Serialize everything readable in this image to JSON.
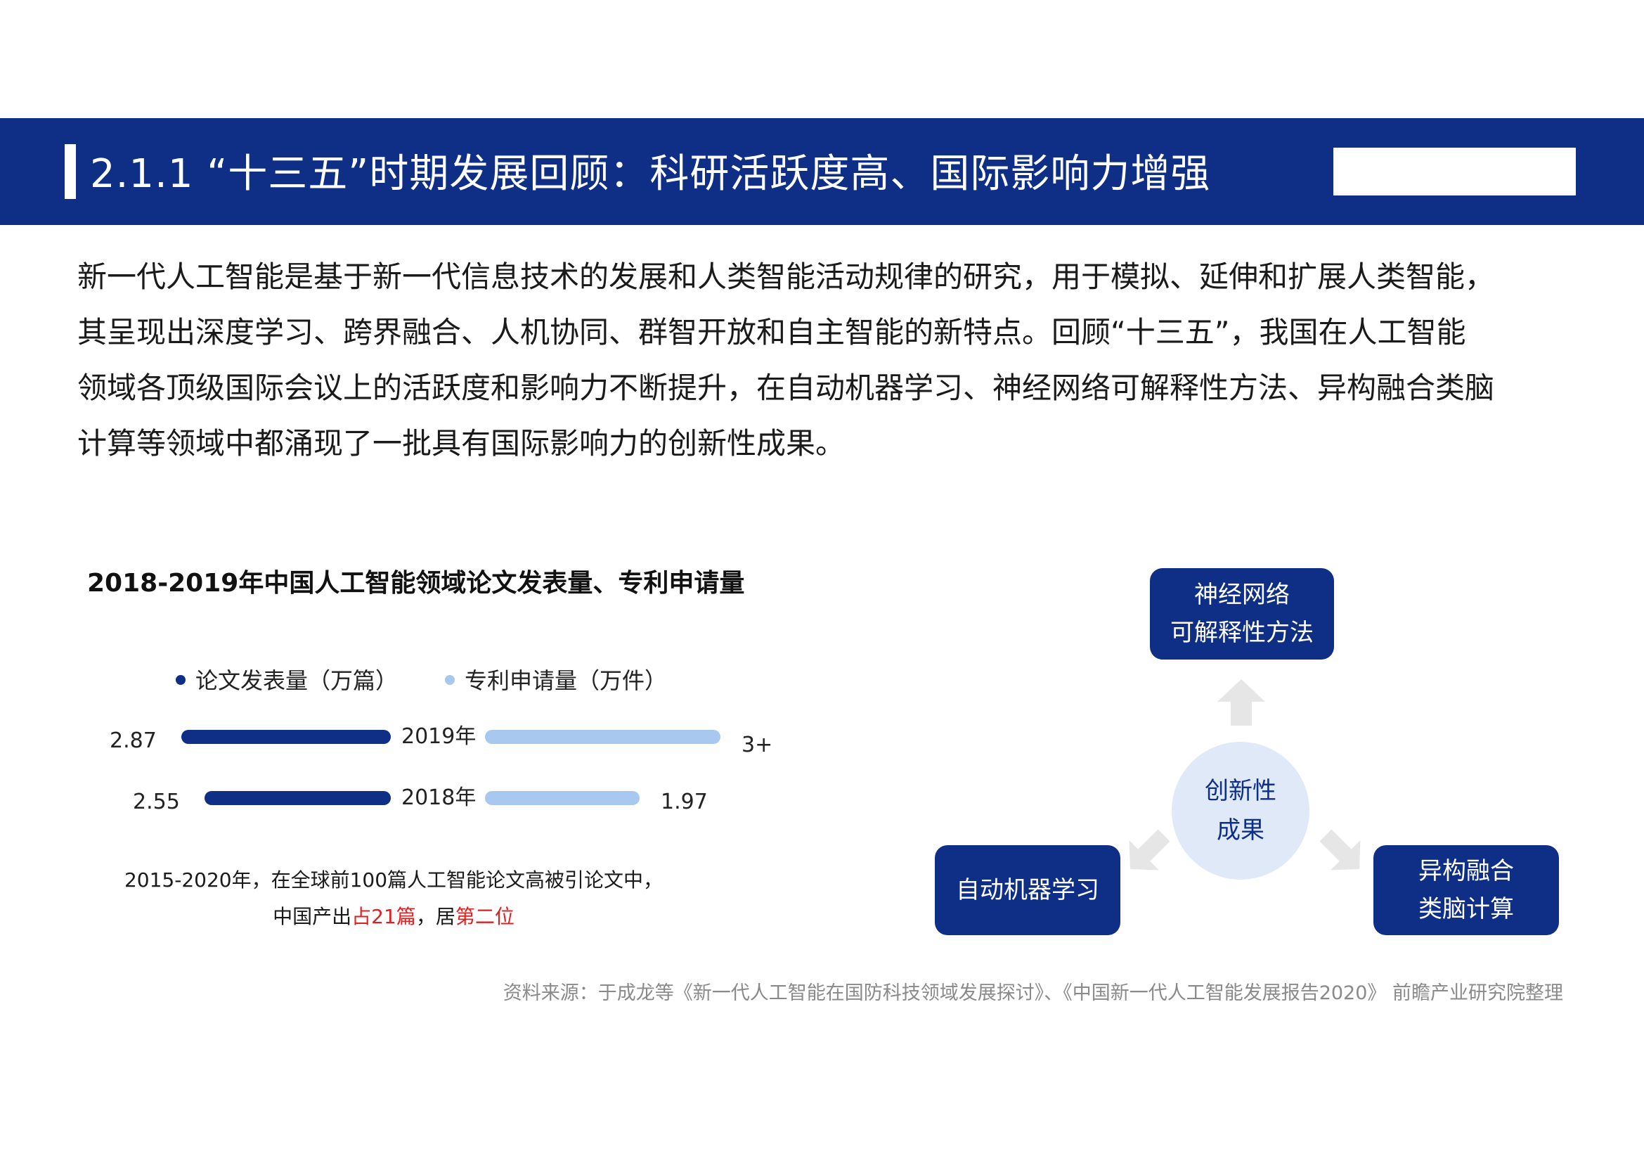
{
  "header": {
    "title": "2.1.1 “十三五”时期发展回顾：科研活跃度高、国际影响力增强"
  },
  "intro": {
    "lines": [
      "新一代人工智能是基于新一代信息技术的发展和人类智能活动规律的研究，用于模拟、延伸和扩展人类智能，",
      "其呈现出深度学习、跨界融合、人机协同、群智开放和自主智能的新特点。回顾“十三五”，我国在人工智能",
      "领域各顶级国际会议上的活跃度和影响力不断提升，在自动机器学习、神经网络可解释性方法、异构融合类脑",
      "计算等领域中都涌现了一批具有国际影响力的创新性成果。"
    ]
  },
  "chart_data": {
    "type": "bar",
    "title": "2018-2019年中国人工智能领域论文发表量、专利申请量",
    "categories": [
      "2019年",
      "2018年"
    ],
    "series": [
      {
        "name": "论文发表量（万篇）",
        "values": [
          2.87,
          2.55
        ],
        "labels": [
          "2.87",
          "2.55"
        ],
        "color": "#0f2f86"
      },
      {
        "name": "专利申请量（万件）",
        "values": [
          3.0,
          1.97
        ],
        "labels": [
          "3+",
          "1.97"
        ],
        "color": "#a9c8f0"
      }
    ],
    "xlim": [
      0,
      3
    ],
    "legend_position": "top",
    "grid": false
  },
  "chart_note": {
    "line1": "2015-2020年，在全球前100篇人工智能论文高被引论文中，",
    "line2_prefix": "中国产出",
    "line2_highlight1": "占21篇",
    "line2_mid": "，居",
    "line2_highlight2": "第二位"
  },
  "diagram": {
    "center": {
      "line1": "创新性",
      "line2": "成果"
    },
    "top": {
      "line1": "神经网络",
      "line2": "可解释性方法"
    },
    "left": {
      "line1": "自动机器学习"
    },
    "right": {
      "line1": "异构融合",
      "line2": "类脑计算"
    }
  },
  "source": "资料来源：于成龙等《新一代人工智能在国防科技领域发展探讨》、《中国新一代人工智能发展报告2020》 前瞻产业研究院整理",
  "colors": {
    "primary": "#0f2f86",
    "secondary": "#a9c8f0",
    "highlight": "#e02020",
    "arrow": "#e6e6e6"
  }
}
